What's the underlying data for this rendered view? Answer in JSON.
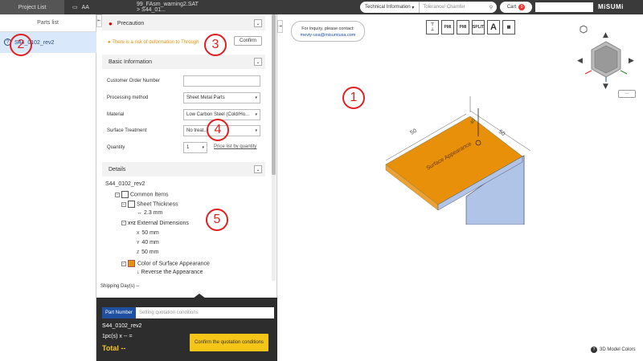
{
  "topbar": {
    "breadcrumb": [
      "Project List",
      "AA",
      "99_FAsm_warning2.SAT > S44_01..."
    ],
    "search_select": "Technical Information",
    "search_placeholder": "Tolerance/ Chamfer",
    "cart_label": "Cart",
    "cart_count": "0",
    "logo": "MiSUMi"
  },
  "parts_list": {
    "header": "Parts list",
    "items": [
      {
        "label": "S44_0102_rev2"
      }
    ]
  },
  "precaution": {
    "header": "Precaution",
    "warning": "There is a risk of deformation to Through",
    "confirm_label": "Confirm"
  },
  "basic_info": {
    "header": "Basic Information",
    "fields": [
      {
        "label": "Customer Order Number",
        "value": ""
      },
      {
        "label": "Processing method",
        "value": "Sheet Metal Parts"
      },
      {
        "label": "Material",
        "value": "Low Carbon Steel (Cold/Ho..."
      },
      {
        "label": "Surface Treatment",
        "value": "No treat..."
      },
      {
        "label": "Quantity",
        "value": "1"
      }
    ],
    "price_link": "Price list by quantity"
  },
  "details": {
    "header": "Details",
    "part_name": "S44_0102_rev2",
    "tree": [
      "Common Items",
      "Sheet Thickness",
      "2.3 mm",
      "External Dimensions",
      "50 mm",
      "40 mm",
      "50 mm",
      "Color of Surface Appearance",
      "Reverse the Appearance"
    ],
    "axis_labels": [
      "XYZ",
      "X",
      "Y",
      "Z"
    ]
  },
  "shipping": {
    "label": "Shipping Day(s) --"
  },
  "quote": {
    "pn_badge": "Part Number",
    "pn_placeholder": "Setting quotation conditions",
    "part_number": "S44_0102_rev2",
    "pieces": "1pc(s)  x -- =",
    "total": "Total --",
    "button_label": "Confirm the quotation conditions"
  },
  "viewer": {
    "inquiry_line1": "For inquiry, please contact:",
    "inquiry_line2": "meviy-usa@misumiusa.com",
    "toolbar": [
      "PMI",
      "PMI",
      "SPLIT",
      "A"
    ],
    "model_label": "Surface Appearance",
    "dims": [
      "50",
      "40",
      "50"
    ],
    "more_label": "···",
    "colors_label": "3D Model Colors",
    "colors": {
      "sheet_top": "#e8900a",
      "sheet_side": "#b0c4e8",
      "accent": "#e02020"
    }
  },
  "markers": [
    "1",
    "2",
    "3",
    "4",
    "5"
  ]
}
